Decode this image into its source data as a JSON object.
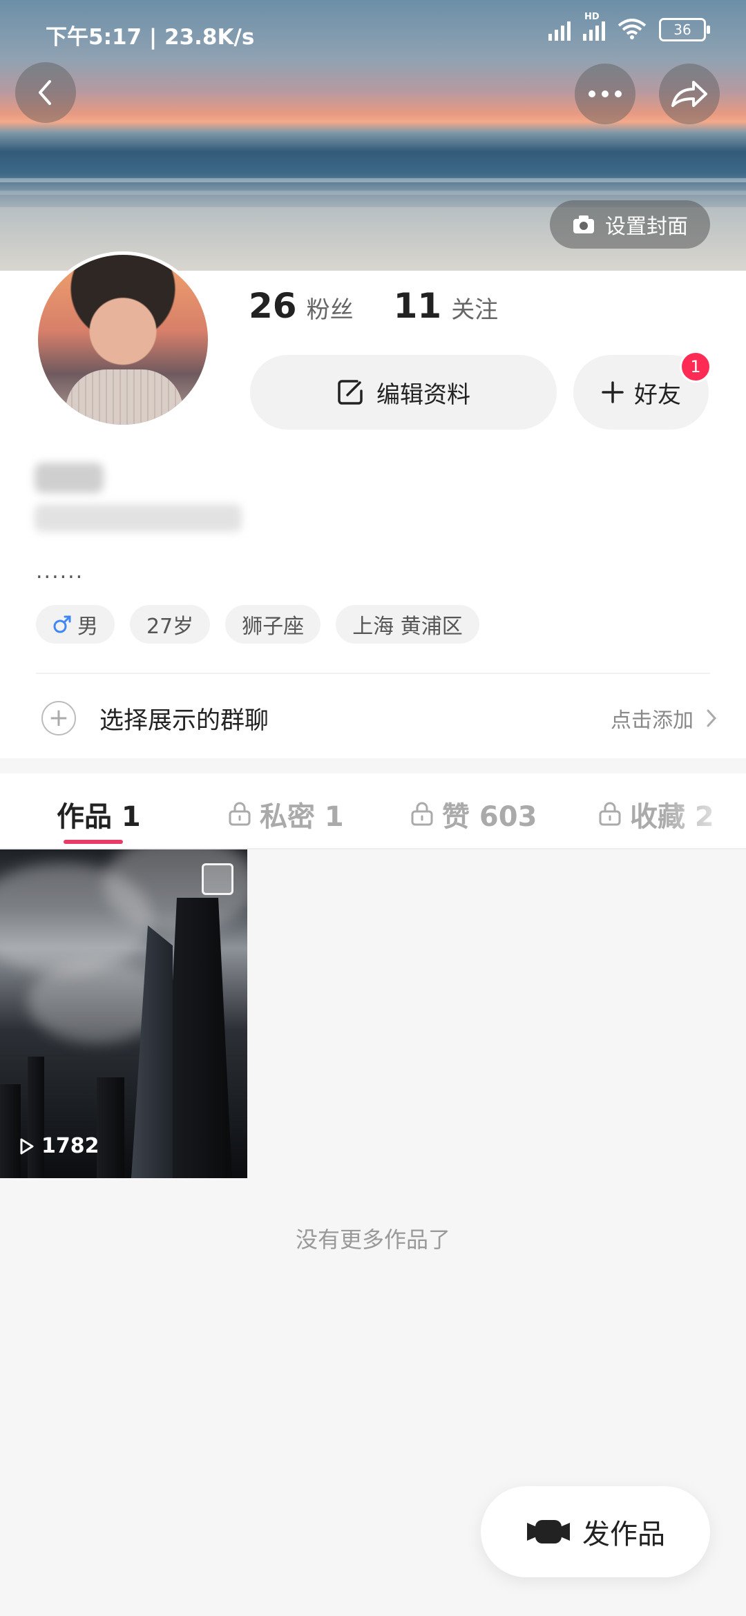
{
  "status_bar": {
    "time_speed": "下午5:17 | 23.8K/s",
    "battery": "36",
    "network_badge": "HD"
  },
  "header": {
    "set_cover_label": "设置封面",
    "icons": {
      "back": "back-icon",
      "more": "more-icon",
      "share": "share-icon",
      "camera": "camera-icon"
    }
  },
  "profile": {
    "followers_count": "26",
    "followers_label": "粉丝",
    "following_count": "11",
    "following_label": "关注",
    "edit_label": "编辑资料",
    "add_friend_label": "好友",
    "friend_badge": "1",
    "bio": "......",
    "tags": [
      "男",
      "27岁",
      "狮子座",
      "上海 黄浦区"
    ],
    "group_chat_label": "选择展示的群聊",
    "group_chat_action": "点击添加"
  },
  "tabs": [
    {
      "label": "作品 1",
      "locked": false,
      "active": true
    },
    {
      "label": "私密 1",
      "locked": true,
      "active": false
    },
    {
      "label": "赞 603",
      "locked": true,
      "active": false
    },
    {
      "label": "收藏 2",
      "locked": true,
      "active": false
    }
  ],
  "videos": [
    {
      "views": "1782"
    }
  ],
  "no_more_text": "没有更多作品了",
  "fab": {
    "label": "发作品"
  },
  "colors": {
    "accent": "#e63d67",
    "badge": "#fe2c55"
  }
}
